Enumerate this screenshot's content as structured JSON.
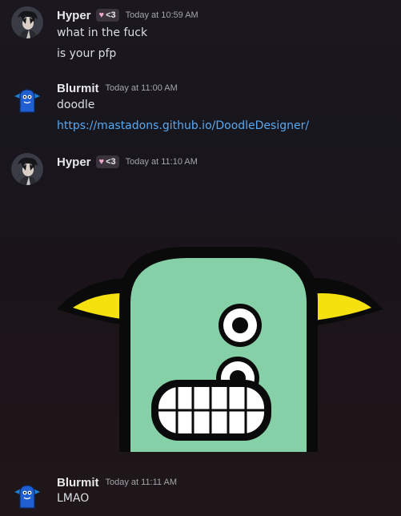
{
  "messages": [
    {
      "author": "Hyper",
      "badge_text": "<3",
      "badge_icon": "heart-icon",
      "timestamp": "Today at 10:59 AM",
      "lines": [
        "what in the fuck",
        "is your pfp"
      ]
    },
    {
      "author": "Blurmit",
      "timestamp": "Today at 11:00 AM",
      "lines": [
        "doodle"
      ],
      "link": "https://mastadons.github.io/DoodleDesigner/"
    },
    {
      "author": "Hyper",
      "badge_text": "<3",
      "badge_icon": "heart-icon",
      "timestamp": "Today at 11:10 AM",
      "attachment": "doodle-monster-image"
    },
    {
      "author": "Blurmit",
      "timestamp": "Today at 11:11 AM",
      "lines": [
        "LMAO"
      ]
    }
  ],
  "colors": {
    "link": "#55a9f3",
    "monster_body": "#86d0a8",
    "monster_horn": "#f4e10e",
    "blurmit_avatar": "#1f5fd1"
  }
}
